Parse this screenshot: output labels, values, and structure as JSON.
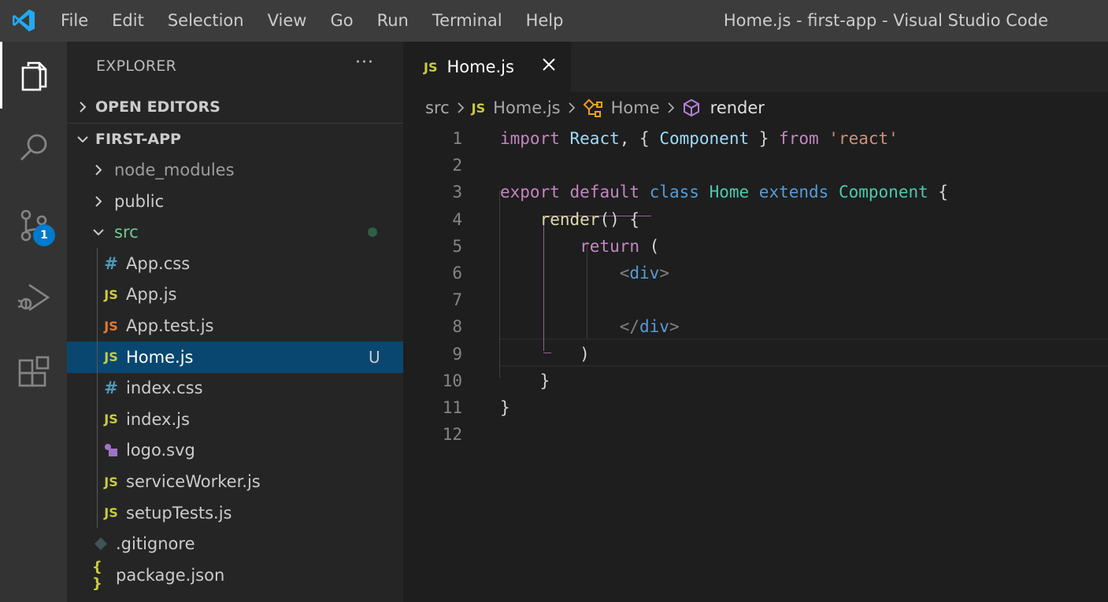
{
  "titlebar": {
    "menu": [
      "File",
      "Edit",
      "Selection",
      "View",
      "Go",
      "Run",
      "Terminal",
      "Help"
    ],
    "window_title": "Home.js - first-app - Visual Studio Code"
  },
  "activitybar": {
    "items": [
      "explorer-icon",
      "search-icon",
      "source-control-icon",
      "run-debug-icon",
      "extensions-icon"
    ],
    "source_control_badge": "1"
  },
  "sidebar": {
    "title": "EXPLORER",
    "more": "···",
    "open_editors": "OPEN EDITORS",
    "project": "FIRST-APP",
    "tree": [
      {
        "label": "node_modules",
        "kind": "folder"
      },
      {
        "label": "public",
        "kind": "folder"
      },
      {
        "label": "src",
        "kind": "folder-open"
      },
      {
        "label": "App.css",
        "kind": "css"
      },
      {
        "label": "App.js",
        "kind": "js"
      },
      {
        "label": "App.test.js",
        "kind": "test"
      },
      {
        "label": "Home.js",
        "kind": "js",
        "badge": "U"
      },
      {
        "label": "index.css",
        "kind": "css"
      },
      {
        "label": "index.js",
        "kind": "js"
      },
      {
        "label": "logo.svg",
        "kind": "svg"
      },
      {
        "label": "serviceWorker.js",
        "kind": "js"
      },
      {
        "label": "setupTests.js",
        "kind": "js"
      },
      {
        "label": ".gitignore",
        "kind": "git"
      },
      {
        "label": "package.json",
        "kind": "json"
      }
    ],
    "icon_text": {
      "js": "JS",
      "css": "#",
      "json": "{ }"
    }
  },
  "editor": {
    "tab": {
      "icon": "JS",
      "label": "Home.js"
    },
    "breadcrumbs": [
      "src",
      "Home.js",
      "Home",
      "render"
    ],
    "breadcrumb_icon": "JS",
    "line_numbers": [
      "1",
      "2",
      "3",
      "4",
      "5",
      "6",
      "7",
      "8",
      "9",
      "10",
      "11",
      "12"
    ],
    "code": [
      [
        [
          "kw",
          "import"
        ],
        [
          "pun",
          " "
        ],
        [
          "var",
          "React"
        ],
        [
          "pun",
          ", { "
        ],
        [
          "var",
          "Component"
        ],
        [
          "pun",
          " } "
        ],
        [
          "kw",
          "from"
        ],
        [
          "pun",
          " "
        ],
        [
          "str",
          "'react'"
        ]
      ],
      [],
      [
        [
          "kw",
          "export"
        ],
        [
          "pun",
          " "
        ],
        [
          "kw",
          "default"
        ],
        [
          "pun",
          " "
        ],
        [
          "kb",
          "class"
        ],
        [
          "pun",
          " "
        ],
        [
          "cls",
          "Home"
        ],
        [
          "pun",
          " "
        ],
        [
          "kb",
          "extends"
        ],
        [
          "pun",
          " "
        ],
        [
          "cls",
          "Component"
        ],
        [
          "pun",
          " {"
        ]
      ],
      [
        [
          "pun",
          "    "
        ],
        [
          "fn",
          "render"
        ],
        [
          "pun",
          "() {"
        ]
      ],
      [
        [
          "pun",
          "        "
        ],
        [
          "kw",
          "return"
        ],
        [
          "pun",
          " ("
        ]
      ],
      [
        [
          "pun",
          "            "
        ],
        [
          "tagb",
          "<"
        ],
        [
          "tag",
          "div"
        ],
        [
          "tagb",
          ">"
        ]
      ],
      [],
      [
        [
          "pun",
          "            "
        ],
        [
          "tagb",
          "</"
        ],
        [
          "tag",
          "div"
        ],
        [
          "tagb",
          ">"
        ]
      ],
      [
        [
          "pun",
          "        )"
        ]
      ],
      [
        [
          "pun",
          "    }"
        ]
      ],
      [
        [
          "pun",
          "}"
        ]
      ],
      []
    ]
  },
  "colors": {
    "accent": "#007acc",
    "selection": "#094771",
    "js_icon": "#cbcb41",
    "css_icon": "#519aba"
  }
}
